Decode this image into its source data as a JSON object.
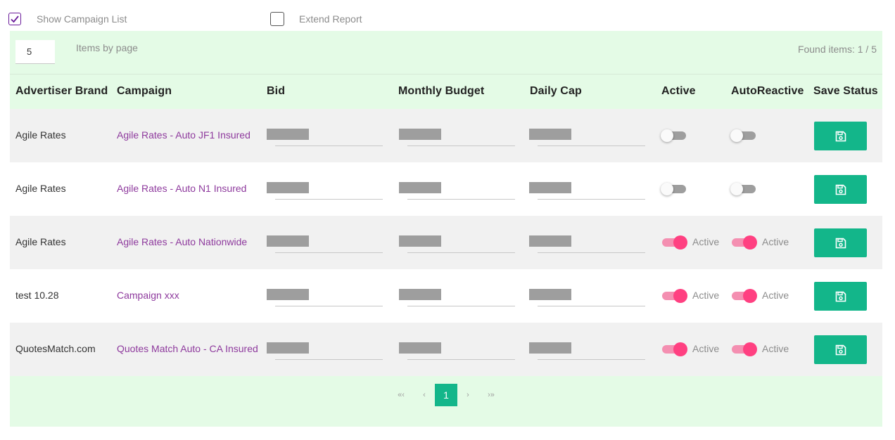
{
  "options": {
    "show_campaign_list": {
      "label": "Show Campaign List",
      "checked": true
    },
    "extend_report": {
      "label": "Extend Report",
      "checked": false
    }
  },
  "toolbar": {
    "items_per_page_value": "5",
    "items_per_page_label": "Items by page",
    "found_items": "Found items: 1 / 5"
  },
  "table": {
    "headers": [
      "Advertiser Brand",
      "Campaign",
      "Bid",
      "Monthly Budget",
      "Daily Cap",
      "Active",
      "AutoReactive",
      "Save Status"
    ],
    "rows": [
      {
        "brand": "Agile Rates",
        "campaign": "Agile Rates - Auto JF1 Insured",
        "active": false,
        "auto_reactive": false,
        "active_label": "",
        "auto_label": ""
      },
      {
        "brand": "Agile Rates",
        "campaign": "Agile Rates - Auto N1 Insured",
        "active": false,
        "auto_reactive": false,
        "active_label": "",
        "auto_label": ""
      },
      {
        "brand": "Agile Rates",
        "campaign": "Agile Rates - Auto Nationwide",
        "active": true,
        "auto_reactive": true,
        "active_label": "Active",
        "auto_label": "Active"
      },
      {
        "brand": "test 10.28",
        "campaign": "Campaign xxx",
        "active": true,
        "auto_reactive": true,
        "active_label": "Active",
        "auto_label": "Active"
      },
      {
        "brand": "QuotesMatch.com",
        "campaign": "Quotes Match Auto - CA Insured",
        "active": true,
        "auto_reactive": true,
        "active_label": "Active",
        "auto_label": "Active"
      }
    ]
  },
  "pagination": {
    "first": "«‹",
    "prev": "‹",
    "current": "1",
    "next": "›",
    "last": "›»"
  },
  "icons": {
    "checkbox_check": "check-icon",
    "save": "floppy-disk-icon"
  },
  "colors": {
    "accent_green": "#13b68a",
    "panel_bg": "#e4fbe6",
    "campaign_link": "#8e3a9d",
    "toggle_on": "#ff4081",
    "checkbox_purple": "#6a1b9a"
  }
}
